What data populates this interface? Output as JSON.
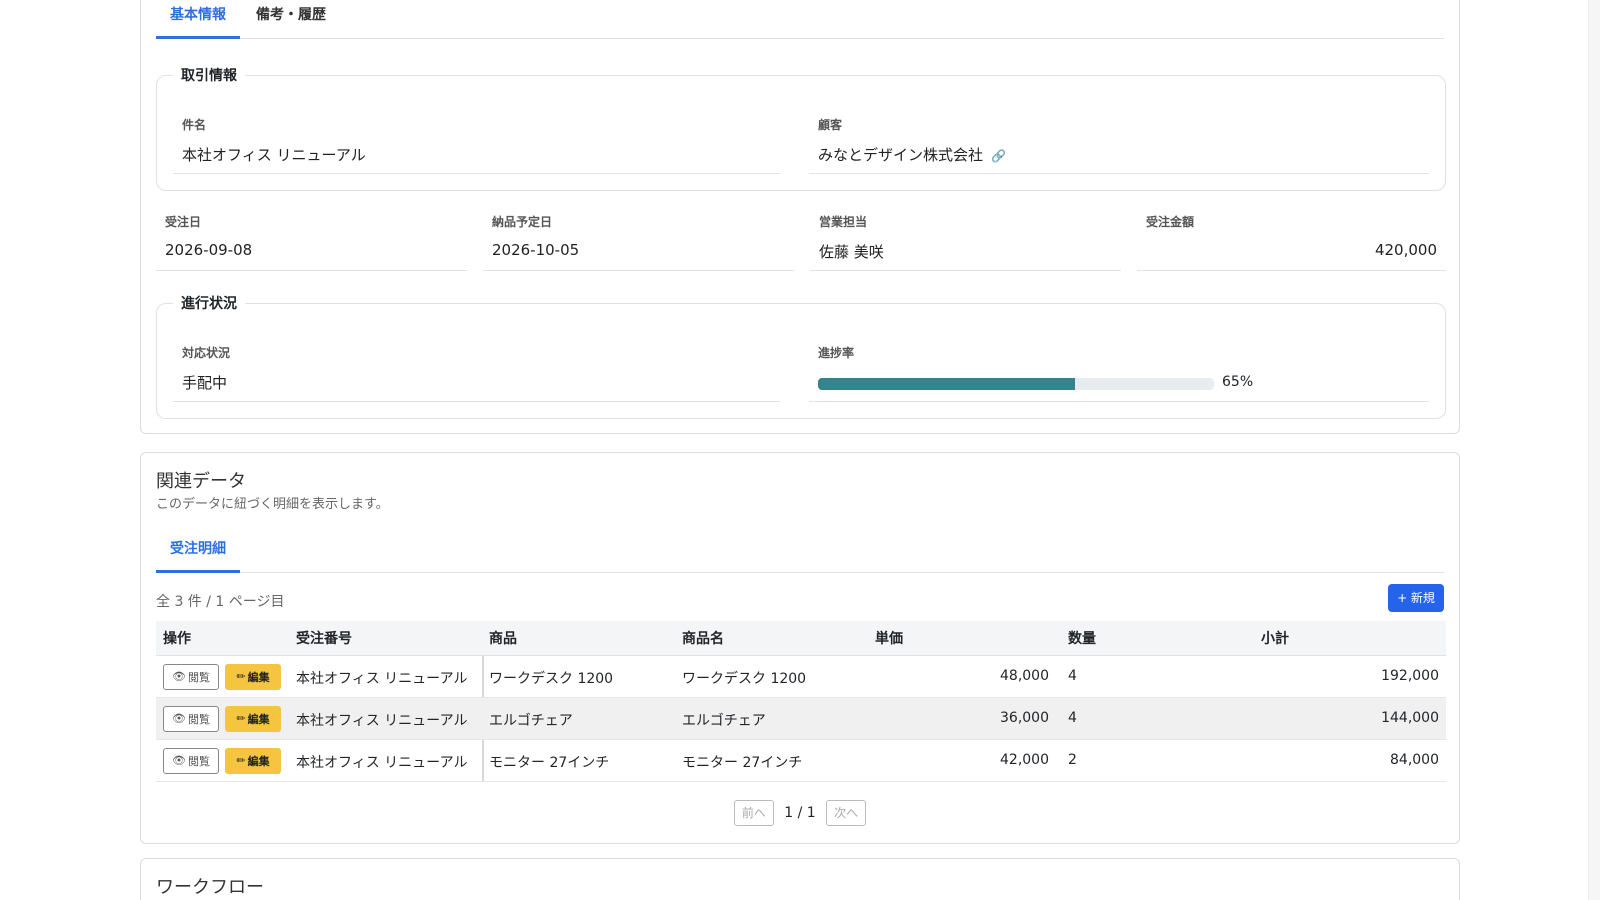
{
  "tabs_top": [
    {
      "label": "基本情報",
      "active": true
    },
    {
      "label": "備考・履歴",
      "active": false
    }
  ],
  "transaction": {
    "legend": "取引情報",
    "subject_label": "件名",
    "subject_value": "本社オフィス リニューアル",
    "customer_label": "顧客",
    "customer_value": "みなとデザイン株式会社"
  },
  "summary": {
    "order_date_label": "受注日",
    "order_date_value": "2026-09-08",
    "delivery_label": "納品予定日",
    "delivery_value": "2026-10-05",
    "sales_rep_label": "営業担当",
    "sales_rep_value": "佐藤 美咲",
    "amount_label": "受注金額",
    "amount_value": "420,000"
  },
  "progress": {
    "legend": "進行状況",
    "status_label": "対応状況",
    "status_value": "手配中",
    "rate_label": "進捗率",
    "rate_value": 65,
    "rate_text": "65%",
    "bar_color": "#35838c"
  },
  "related": {
    "title": "関連データ",
    "subtitle": "このデータに紐づく明細を表示します。",
    "tab": "受注明細",
    "count_text": "全 3 件 / 1 ページ目",
    "new_label": "+ 新規",
    "columns": [
      "操作",
      "受注番号",
      "商品",
      "商品名",
      "単価",
      "数量",
      "小計"
    ],
    "view_label": "閲覧",
    "edit_label": "編集",
    "rows": [
      {
        "order": "本社オフィス リニューアル",
        "product": "ワークデスク 1200",
        "product_name": "ワークデスク 1200",
        "unit_price": "48,000",
        "qty": "4",
        "subtotal": "192,000"
      },
      {
        "order": "本社オフィス リニューアル",
        "product": "エルゴチェア",
        "product_name": "エルゴチェア",
        "unit_price": "36,000",
        "qty": "4",
        "subtotal": "144,000"
      },
      {
        "order": "本社オフィス リニューアル",
        "product": "モニター 27インチ",
        "product_name": "モニター 27インチ",
        "unit_price": "42,000",
        "qty": "2",
        "subtotal": "84,000"
      }
    ],
    "prev_label": "前へ",
    "page_info": "1 / 1",
    "next_label": "次へ"
  },
  "workflow": {
    "title": "ワークフロー"
  },
  "colors": {
    "accent": "#2f6fe0",
    "new_button": "#2563eb",
    "edit_button": "#f5c542"
  }
}
